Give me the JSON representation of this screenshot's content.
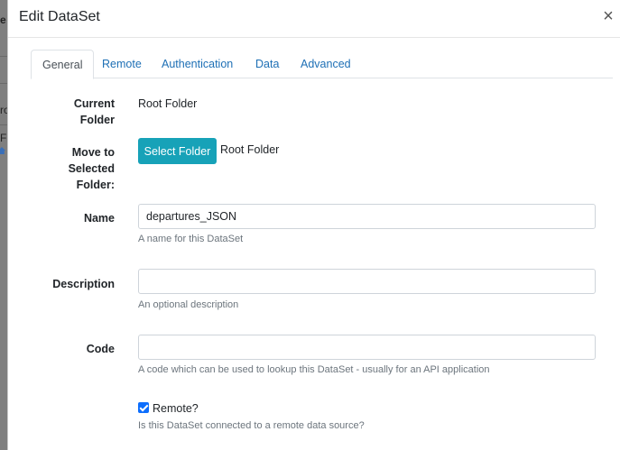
{
  "dialog": {
    "title": "Edit DataSet",
    "close_glyph": "×"
  },
  "background": {
    "fragments": [
      "e",
      "ro",
      "F"
    ]
  },
  "tabs": [
    {
      "label": "General",
      "active": true
    },
    {
      "label": "Remote",
      "active": false
    },
    {
      "label": "Authentication",
      "active": false
    },
    {
      "label": "Data",
      "active": false
    },
    {
      "label": "Advanced",
      "active": false
    }
  ],
  "form": {
    "current_folder": {
      "label_line1": "Current",
      "label_line2": "Folder",
      "value": "Root Folder"
    },
    "move_folder": {
      "label_line1": "Move to",
      "label_line2": "Selected",
      "label_line3": "Folder:",
      "button_label": "Select Folder",
      "value": "Root Folder"
    },
    "name": {
      "label": "Name",
      "value": "departures_JSON",
      "help": "A name for this DataSet"
    },
    "description": {
      "label": "Description",
      "value": "",
      "help": "An optional description"
    },
    "code": {
      "label": "Code",
      "value": "",
      "help": "A code which can be used to lookup this DataSet - usually for an API application"
    },
    "remote": {
      "label": "Remote?",
      "checked": true,
      "help": "Is this DataSet connected to a remote data source?"
    }
  },
  "colors": {
    "accent": "#17a2b8",
    "link": "#1d6fb5",
    "checkbox": "#0d6efd"
  }
}
